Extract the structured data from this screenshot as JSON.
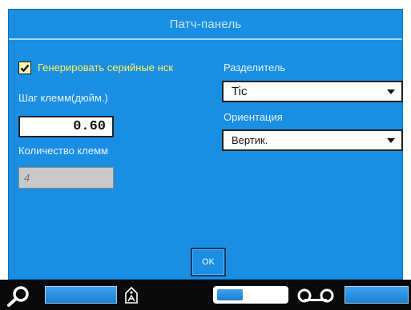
{
  "dialog": {
    "title": "Патч-панель",
    "generate_serial_label": "Генерировать серийные нск",
    "generate_serial_checked": true,
    "terminal_pitch_label": "Шаг клемм(дюйм.)",
    "terminal_pitch_value": "0.60",
    "terminal_count_label": "Количество клемм",
    "terminal_count_value": "4",
    "separator_label": "Разделитель",
    "separator_value": "Tic",
    "orientation_label": "Ориентация",
    "orientation_value": "Вертик.",
    "ok_label": "OK"
  },
  "statusbar": {
    "icons": [
      "search-icon",
      "label-tag-icon",
      "tape-cassette-icon"
    ],
    "accent": "#1a8ee3"
  }
}
